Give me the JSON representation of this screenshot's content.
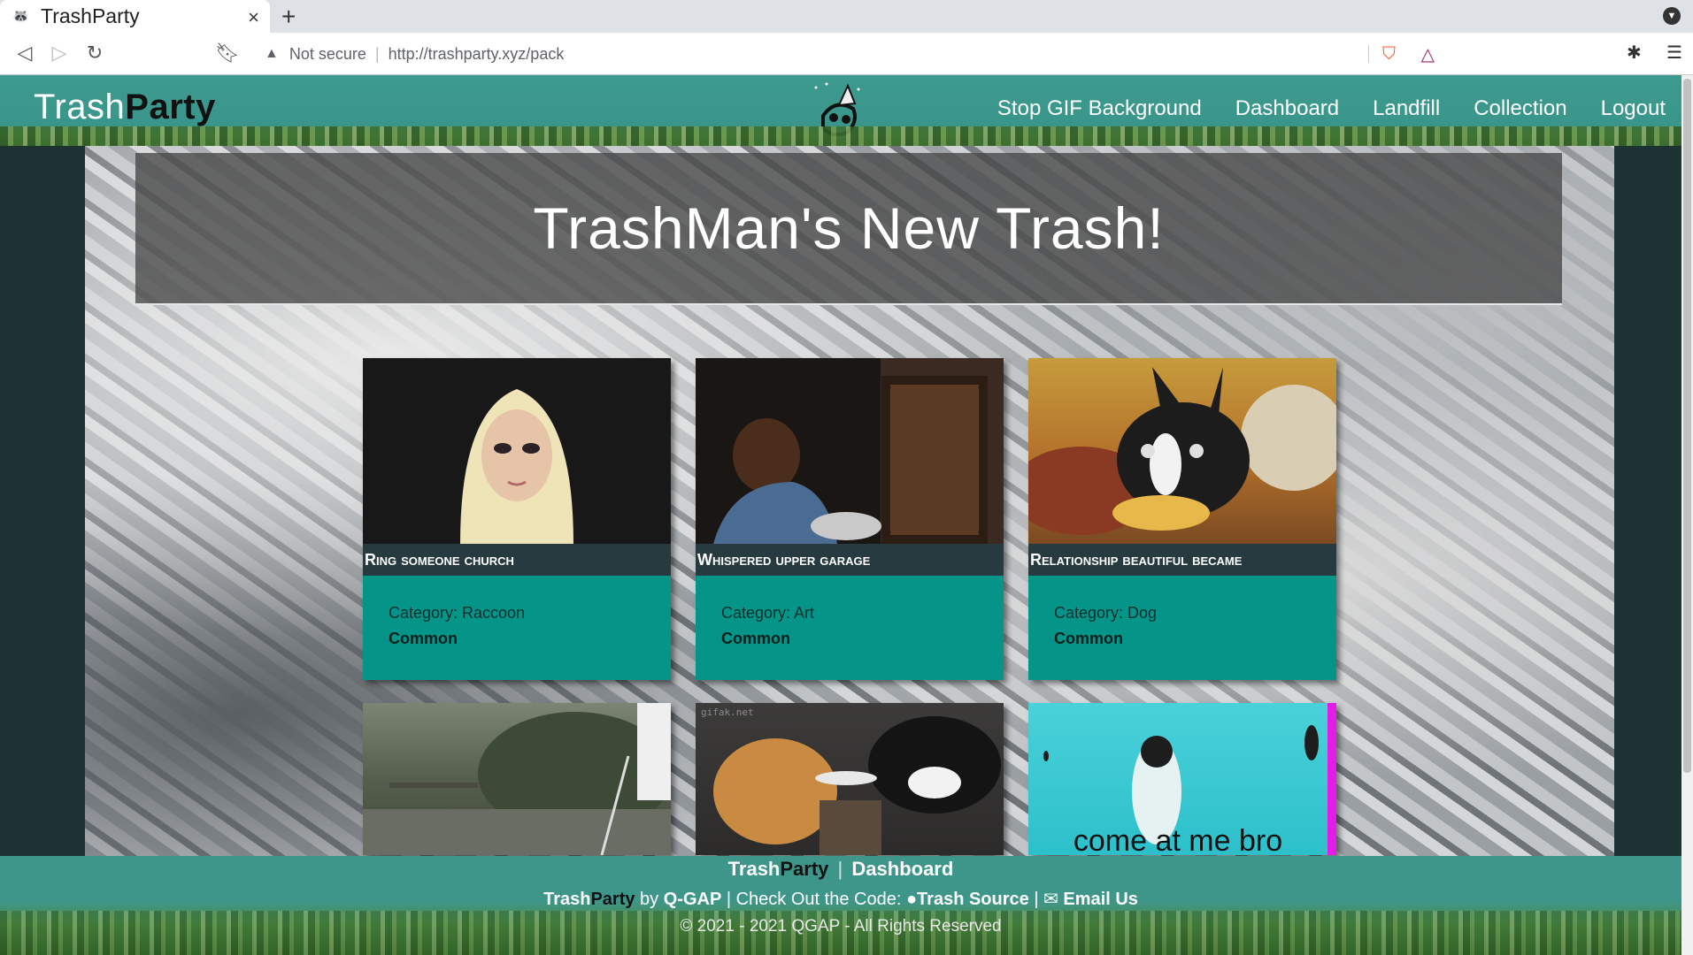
{
  "browser": {
    "tab_title": "TrashParty",
    "tab_close": "×",
    "new_tab": "+",
    "security_label": "Not secure",
    "url": "http://trashparty.xyz/pack"
  },
  "header": {
    "brand_light": "Trash",
    "brand_bold": "Party",
    "nav": {
      "stop_gif": "Stop GIF Background",
      "dashboard": "Dashboard",
      "landfill": "Landfill",
      "collection": "Collection",
      "logout": "Logout"
    }
  },
  "hero": {
    "title": "TrashMan's New Trash!"
  },
  "cards": [
    {
      "title": "Ring someone church",
      "category": "Category: Raccoon",
      "rarity": "Common"
    },
    {
      "title": "Whispered upper garage",
      "category": "Category: Art",
      "rarity": "Common"
    },
    {
      "title": "Relationship beautiful became",
      "category": "Category: Dog",
      "rarity": "Common"
    },
    {
      "image_caption": ""
    },
    {
      "image_caption": "gifak.net"
    },
    {
      "image_caption": "come at me bro"
    }
  ],
  "footer": {
    "brand_light": "Trash",
    "brand_bold": "Party",
    "separator": "|",
    "dashboard": "Dashboard",
    "by": "by",
    "author": "Q-GAP",
    "check_code": "| Check Out the Code:",
    "source": "Trash Source",
    "pipe": "|",
    "email": "Email Us",
    "copyright": "© 2021 - 2021 QGAP - All Rights Reserved"
  },
  "colors": {
    "header_teal": "#3d9a8e",
    "card_teal": "#049488",
    "card_title_bar": "#263a3f",
    "dark_side": "#1d3233"
  }
}
